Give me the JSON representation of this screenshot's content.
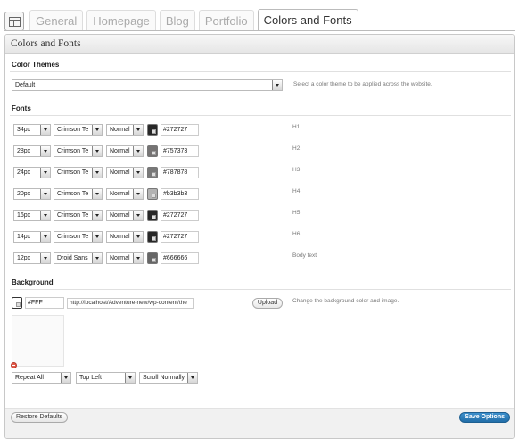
{
  "tabs": [
    {
      "label": "General"
    },
    {
      "label": "Homepage"
    },
    {
      "label": "Blog"
    },
    {
      "label": "Portfolio"
    },
    {
      "label": "Colors and Fonts",
      "active": true
    }
  ],
  "panel": {
    "title": "Colors and Fonts"
  },
  "color_themes": {
    "heading": "Color Themes",
    "selected": "Default",
    "description": "Select a color theme to be applied across the website."
  },
  "fonts": {
    "heading": "Fonts",
    "rows": [
      {
        "size": "34px",
        "family": "Crimson Te",
        "weight": "Normal",
        "color": "#272727",
        "label": "H1"
      },
      {
        "size": "28px",
        "family": "Crimson Te",
        "weight": "Normal",
        "color": "#757373",
        "label": "H2"
      },
      {
        "size": "24px",
        "family": "Crimson Te",
        "weight": "Normal",
        "color": "#787878",
        "label": "H3"
      },
      {
        "size": "20px",
        "family": "Crimson Te",
        "weight": "Normal",
        "color": "#b3b3b3",
        "label": "H4"
      },
      {
        "size": "16px",
        "family": "Crimson Te",
        "weight": "Normal",
        "color": "#272727",
        "label": "H5"
      },
      {
        "size": "14px",
        "family": "Crimson Te",
        "weight": "Normal",
        "color": "#272727",
        "label": "H6"
      },
      {
        "size": "12px",
        "family": "Droid Sans",
        "weight": "Normal",
        "color": "#666666",
        "label": "Body text"
      }
    ]
  },
  "background": {
    "heading": "Background",
    "color": "#FFF",
    "image_url": "http://localhost/Adventure-new/wp-content/the",
    "upload_label": "Upload",
    "description": "Change the background color and image.",
    "repeat": "Repeat All",
    "position": "Top Left",
    "attachment": "Scroll Normally"
  },
  "footer": {
    "restore_label": "Restore Defaults",
    "save_label": "Save Options"
  },
  "colors": {
    "primary_button": "#2a78b5",
    "header_bg": "#ebebeb"
  }
}
